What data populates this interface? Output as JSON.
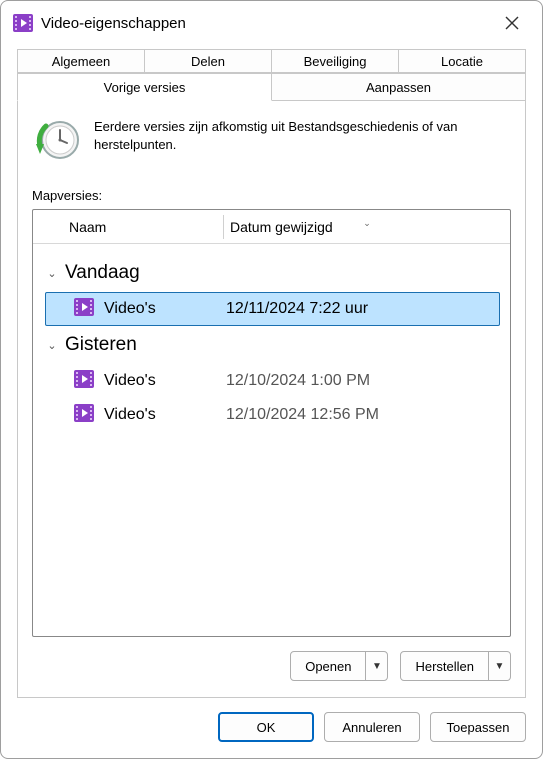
{
  "title": "Video-eigenschappen",
  "tabs_row1": [
    "Algemeen",
    "Delen",
    "Beveiliging",
    "Locatie"
  ],
  "tabs_row2": [
    "Vorige versies",
    "Aanpassen"
  ],
  "active_tab": "Vorige versies",
  "description": "Eerdere versies zijn afkomstig uit Bestandsgeschiedenis of van herstelpunten.",
  "list_label": "Mapversies:",
  "columns": {
    "name": "Naam",
    "date": "Datum gewijzigd"
  },
  "groups": [
    {
      "label": "Vandaag",
      "items": [
        {
          "name": "Video's",
          "date": "12/11/2024 7:22 uur",
          "selected": true
        }
      ]
    },
    {
      "label": "Gisteren",
      "items": [
        {
          "name": "Video's",
          "date": "12/10/2024 1:00 PM",
          "selected": false
        },
        {
          "name": "Video's",
          "date": "12/10/2024 12:56 PM",
          "selected": false
        }
      ]
    }
  ],
  "actions": {
    "open": "Openen",
    "restore": "Herstellen"
  },
  "footer": {
    "ok": "OK",
    "cancel": "Annuleren",
    "apply": "Toepassen"
  }
}
